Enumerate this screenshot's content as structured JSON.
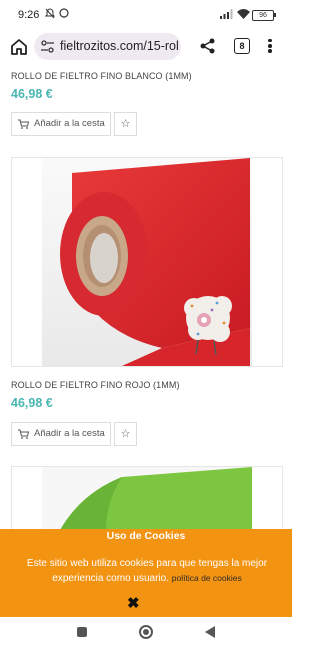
{
  "status_bar": {
    "time": "9:26",
    "battery": "96"
  },
  "browser": {
    "url": "fieltrozitos.com/15-rol",
    "tab_count": "8"
  },
  "products": [
    {
      "title": "ROLLO DE FIELTRO FINO BLANCO (1MM)",
      "price": "46,98 €",
      "cart_label": "Añadir a la cesta"
    },
    {
      "title": "ROLLO DE FIELTRO FINO ROJO (1MM)",
      "price": "46,98 €",
      "cart_label": "Añadir a la cesta",
      "image_color": "#e3232c"
    },
    {
      "image_color": "#7dc641"
    }
  ],
  "cookie_banner": {
    "title": "Uso de Cookies",
    "text": "Este sitio web utiliza cookies para que tengas la mejor experiencia como usuario.",
    "link": "política de cookies",
    "bg_color": "#f39312"
  }
}
